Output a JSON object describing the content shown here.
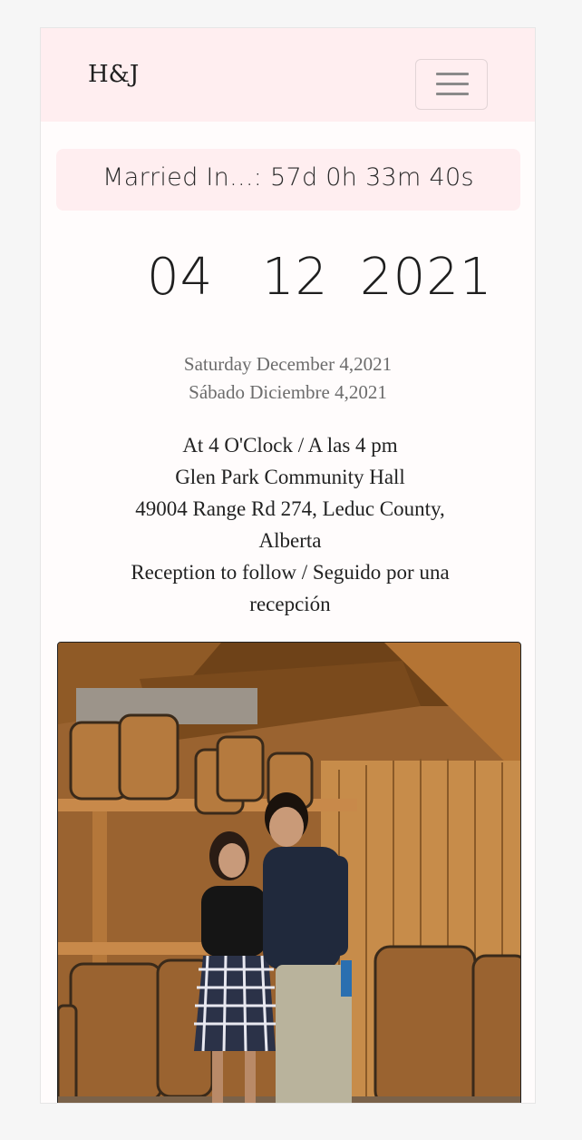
{
  "navbar": {
    "brand": "H&J",
    "toggler_icon": "hamburger-menu-icon"
  },
  "countdown": {
    "label": "Married In...: 57d 0h 33m 40s"
  },
  "date": {
    "day": "04",
    "month": "12",
    "year": "2021",
    "english": "Saturday December 4,2021",
    "spanish": "Sábado Diciembre 4,2021"
  },
  "details": {
    "time": "At 4 O'Clock / A las 4 pm",
    "venue": "Glen Park Community Hall",
    "address_line1": "49004 Range Rd 274, Leduc County,",
    "address_line2": "Alberta",
    "reception_line1": "Reception to follow / Seguido por una",
    "reception_line2": "recepción"
  },
  "photo": {
    "subject": "couple-photo-barrels"
  },
  "colors": {
    "navbar_bg": "#ffeef0",
    "page_bg": "#fffcfc",
    "text": "#222222",
    "muted_text": "#6c6c6c"
  }
}
